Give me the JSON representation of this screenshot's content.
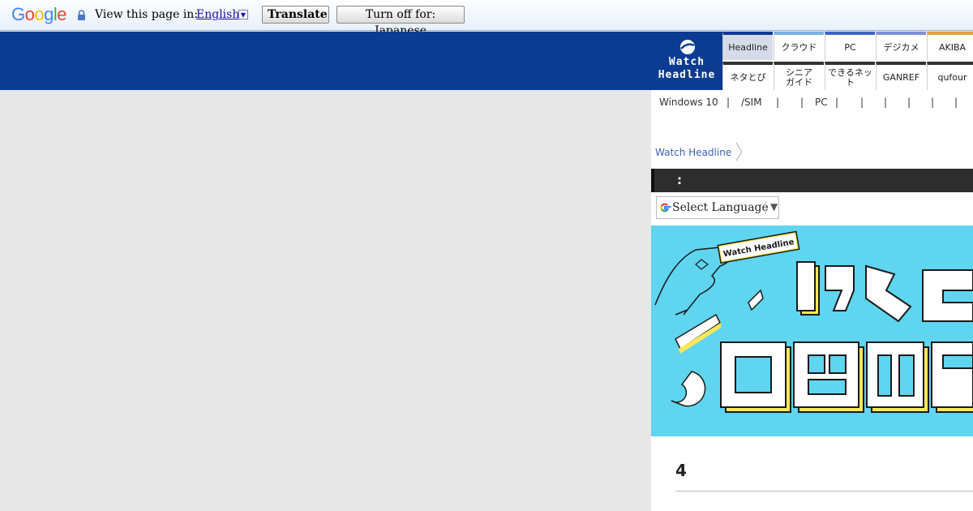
{
  "translate_bar": {
    "logo": [
      "G",
      "o",
      "o",
      "g",
      "l",
      "e"
    ],
    "logo_colors": [
      "#4285f4",
      "#ea4335",
      "#fbbc05",
      "#4285f4",
      "#34a853",
      "#ea4335"
    ],
    "label": "View this page in:",
    "language": "English",
    "translate_button": "Translate",
    "turn_off_button": "Turn off for: Japanese"
  },
  "header": {
    "logo_line1": "Watch",
    "logo_line2": "Headline",
    "nav_top": [
      {
        "label": "Headline",
        "color": "#0c3b92"
      },
      {
        "label": "クラウド",
        "color": "#7ab0e0"
      },
      {
        "label": "PC",
        "color": "#3f63c8"
      },
      {
        "label": "デジカメ",
        "color": "#7e8fd6"
      },
      {
        "label": "AKIBA",
        "color": "#e0a040"
      }
    ],
    "nav_bottom": [
      "ネタとぴ",
      "シニア\nガイド",
      "できるネット",
      "GANREF",
      "qufour"
    ]
  },
  "subnav": {
    "items": [
      "Windows 10",
      "|",
      "/SIM",
      "|",
      "|",
      "PC",
      "|",
      "|",
      "|",
      "|",
      "|",
      "|"
    ]
  },
  "main": {
    "breadcrumb": "Watch Headline",
    "bar_title": ":",
    "select_language": "Select Language",
    "banner_tag": "Watch Headline",
    "article_number": "4"
  }
}
